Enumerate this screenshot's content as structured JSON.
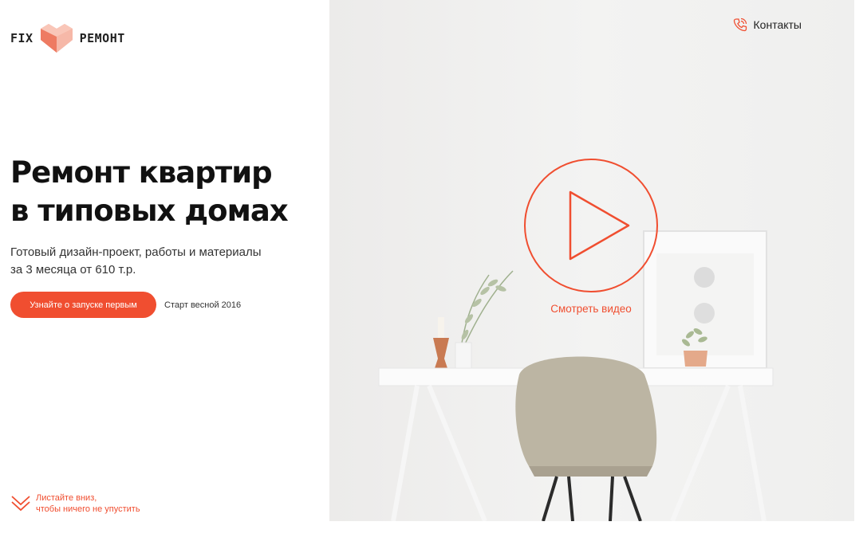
{
  "brand": {
    "logo_left": "FIX",
    "logo_right": "РЕМОНТ",
    "accent_color": "#f04e30"
  },
  "hero": {
    "headline_line1": "Ремонт квартир",
    "headline_line2": "в типовых домах",
    "subtitle_line1": "Готовый дизайн-проект, работы и материалы",
    "subtitle_line2": "за 3 месяца от 610 т.р.",
    "cta_label": "Узнайте о запуске первым",
    "cta_note": "Старт весной 2016",
    "video_label": "Смотреть видео"
  },
  "nav": {
    "contacts_label": "Контакты",
    "contacts_icon": "phone-icon"
  },
  "scroll_hint": {
    "line1": "Листайте вниз,",
    "line2": "чтобы ничего не упустить",
    "icon": "chevron-down-icon"
  }
}
